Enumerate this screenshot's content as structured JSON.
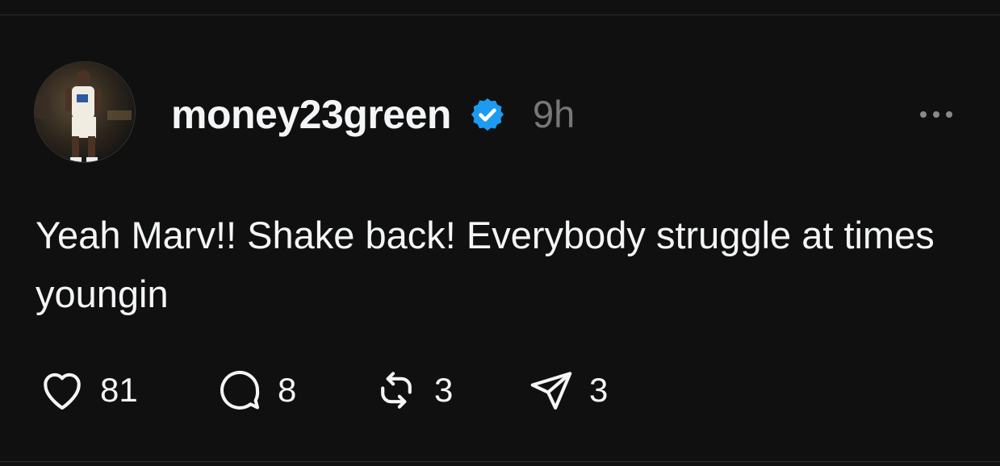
{
  "post": {
    "username": "money23green",
    "verified": true,
    "timestamp": "9h",
    "text": "Yeah Marv!! Shake back! Everybody struggle at times youngin",
    "avatar": "basketball-player-avatar"
  },
  "actions": {
    "likes": "81",
    "replies": "8",
    "reposts": "3",
    "shares": "3"
  },
  "icons": {
    "like": "heart-icon",
    "reply": "speech-bubble-icon",
    "repost": "repost-icon",
    "share": "paper-plane-icon",
    "more": "more-dots-icon",
    "verified": "verified-badge-icon"
  },
  "colors": {
    "background": "#101010",
    "text": "#f3f5f7",
    "muted": "#777777",
    "verified": "#1d9bf0"
  }
}
